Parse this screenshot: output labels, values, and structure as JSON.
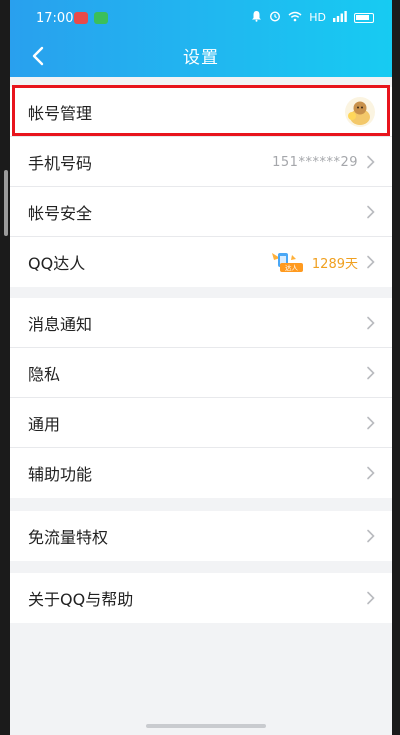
{
  "status": {
    "time": "17:00",
    "network": "HD"
  },
  "header": {
    "title": "设置",
    "back_icon": "chevron-left-icon"
  },
  "account": {
    "label": "帐号管理"
  },
  "phone": {
    "label": "手机号码",
    "value": "151******29"
  },
  "security": {
    "label": "帐号安全"
  },
  "qqdaren": {
    "label": "QQ达人",
    "badge": "达人",
    "days": "1289天"
  },
  "notify": {
    "label": "消息通知"
  },
  "privacy": {
    "label": "隐私"
  },
  "general": {
    "label": "通用"
  },
  "assist": {
    "label": "辅助功能"
  },
  "freeflow": {
    "label": "免流量特权"
  },
  "about": {
    "label": "关于QQ与帮助"
  },
  "colors": {
    "header_start": "#29a0ee",
    "header_end": "#17cbf2",
    "highlight_border": "#e8141c",
    "days_text": "#f0a020"
  }
}
